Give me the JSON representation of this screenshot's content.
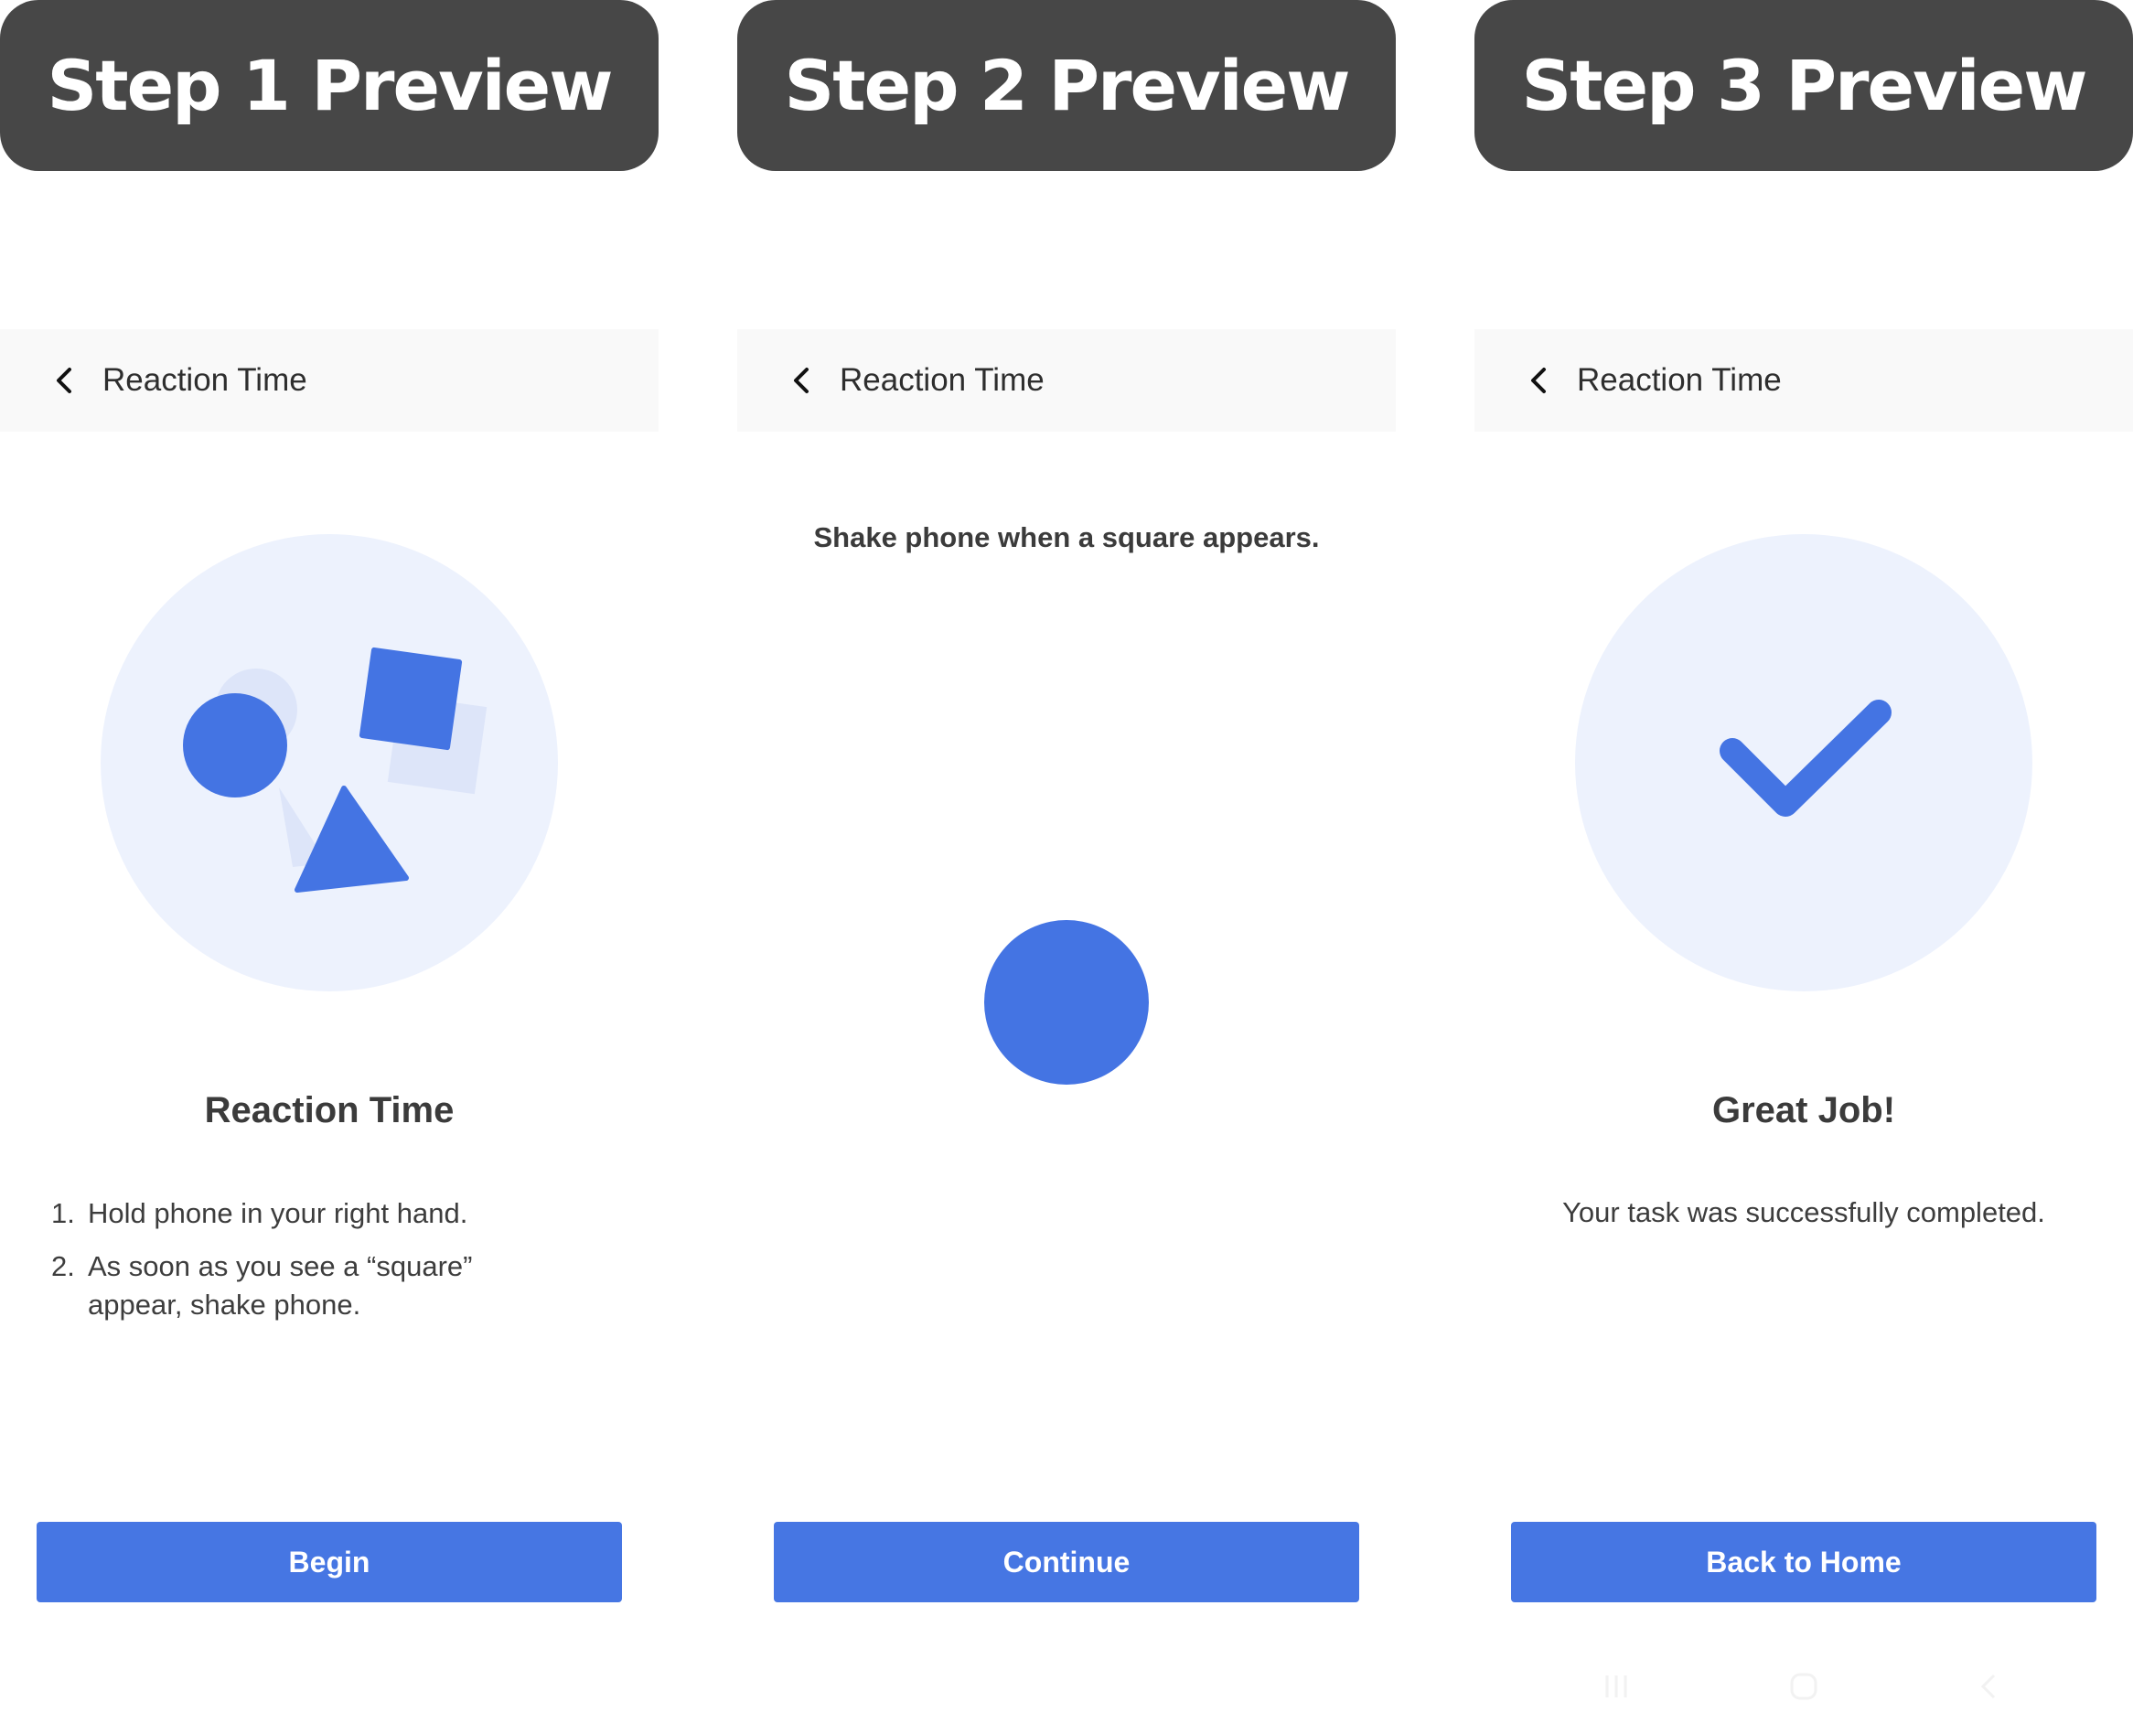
{
  "colors": {
    "header_bg": "#474747",
    "accent": "#4676e3",
    "illustration_bg": "#edf2fd",
    "appbar_bg": "#f9f9f9"
  },
  "step1": {
    "header": "Step 1 Preview",
    "appbar": {
      "title": "Reaction Time",
      "back_icon": "chevron-left-icon"
    },
    "illustration": "shapes-illustration",
    "heading": "Reaction Time",
    "instructions": [
      {
        "num": "1.",
        "text": "Hold phone in your right hand."
      },
      {
        "num": "2.",
        "text": "As soon as you see a “square” appear, shake phone."
      }
    ],
    "button": "Begin"
  },
  "step2": {
    "header": "Step 2 Preview",
    "appbar": {
      "title": "Reaction Time",
      "back_icon": "chevron-left-icon"
    },
    "prompt": "Shake phone when a square appears.",
    "stimulus": "circle-shape",
    "button": "Continue"
  },
  "step3": {
    "header": "Step 3 Preview",
    "appbar": {
      "title": "Reaction Time",
      "back_icon": "chevron-left-icon"
    },
    "illustration": "checkmark-icon",
    "heading": "Great Job!",
    "subtext": "Your task was successfully completed.",
    "button": "Back to Home",
    "system_nav": [
      "recents-icon",
      "home-icon",
      "back-icon"
    ]
  }
}
